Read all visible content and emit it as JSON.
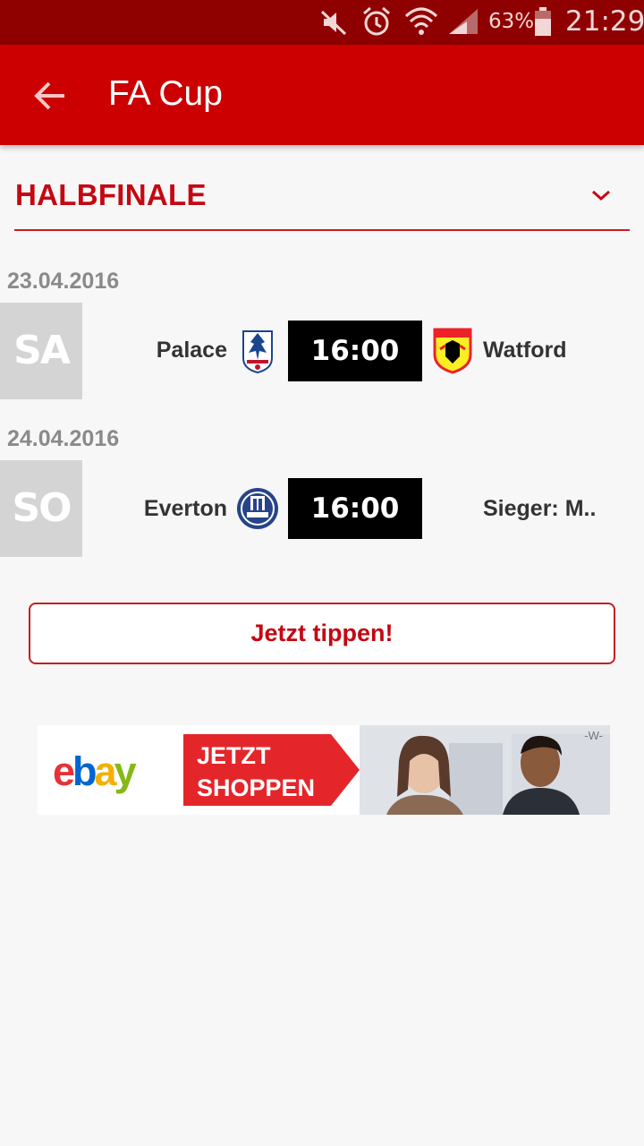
{
  "status_bar": {
    "battery_percent": "63%",
    "time": "21:29"
  },
  "app_bar": {
    "title": "FA Cup",
    "back_icon": "arrow-back-icon"
  },
  "round_selector": {
    "label": "HALBFINALE",
    "icon": "chevron-down-icon"
  },
  "matches": [
    {
      "date": "23.04.2016",
      "day": "SA",
      "home_team": "Palace",
      "home_crest": "crystal-palace-crest-icon",
      "time": "16:00",
      "away_team": "Watford",
      "away_crest": "watford-crest-icon"
    },
    {
      "date": "24.04.2016",
      "day": "SO",
      "home_team": "Everton",
      "home_crest": "everton-crest-icon",
      "time": "16:00",
      "away_team": "Sieger: M.."
    }
  ],
  "tip_button": {
    "label": "Jetzt tippen!"
  },
  "ad": {
    "cta_line1": "JETZT",
    "cta_line2": "SHOPPEN",
    "mark": "-W-",
    "colors": {
      "cta": "#e4262b",
      "ebay_red": "#e53238",
      "ebay_blue": "#0064d2",
      "ebay_yellow": "#f5af02",
      "ebay_green": "#86b817"
    }
  },
  "colors": {
    "status_bar": "#8f0000",
    "app_bar": "#cc0000",
    "accent": "#c40812",
    "day_box": "#d4d4d4"
  }
}
